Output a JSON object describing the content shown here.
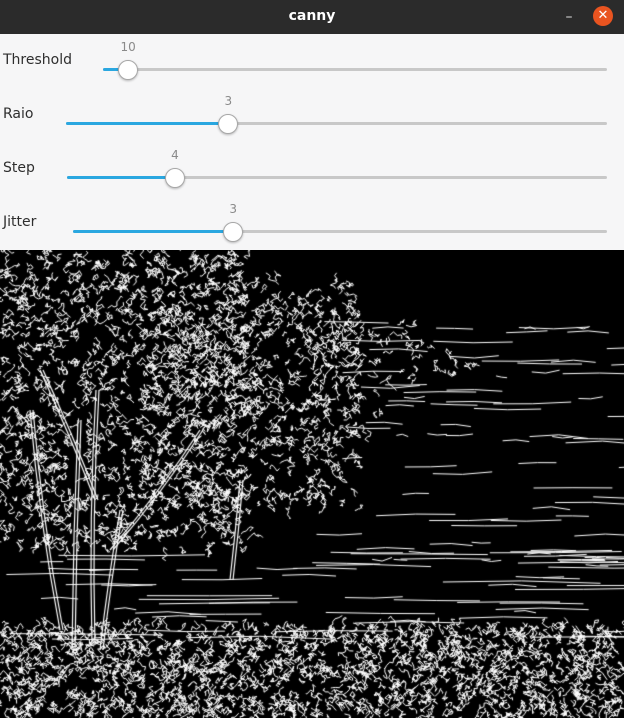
{
  "window": {
    "title": "canny",
    "minimize_glyph": "–",
    "close_glyph": "✕"
  },
  "sliders": [
    {
      "label": "Threshold",
      "value": "10",
      "fraction": 0.05
    },
    {
      "label": "Raio",
      "value": "3",
      "fraction": 0.3
    },
    {
      "label": "Step",
      "value": "4",
      "fraction": 0.2
    },
    {
      "label": "Jitter",
      "value": "3",
      "fraction": 0.3
    }
  ],
  "image": {
    "icon": "canny-edge-image"
  },
  "colors": {
    "accent": "#2aa7e0",
    "close": "#e95420",
    "titlebar": "#2b2b2b"
  }
}
